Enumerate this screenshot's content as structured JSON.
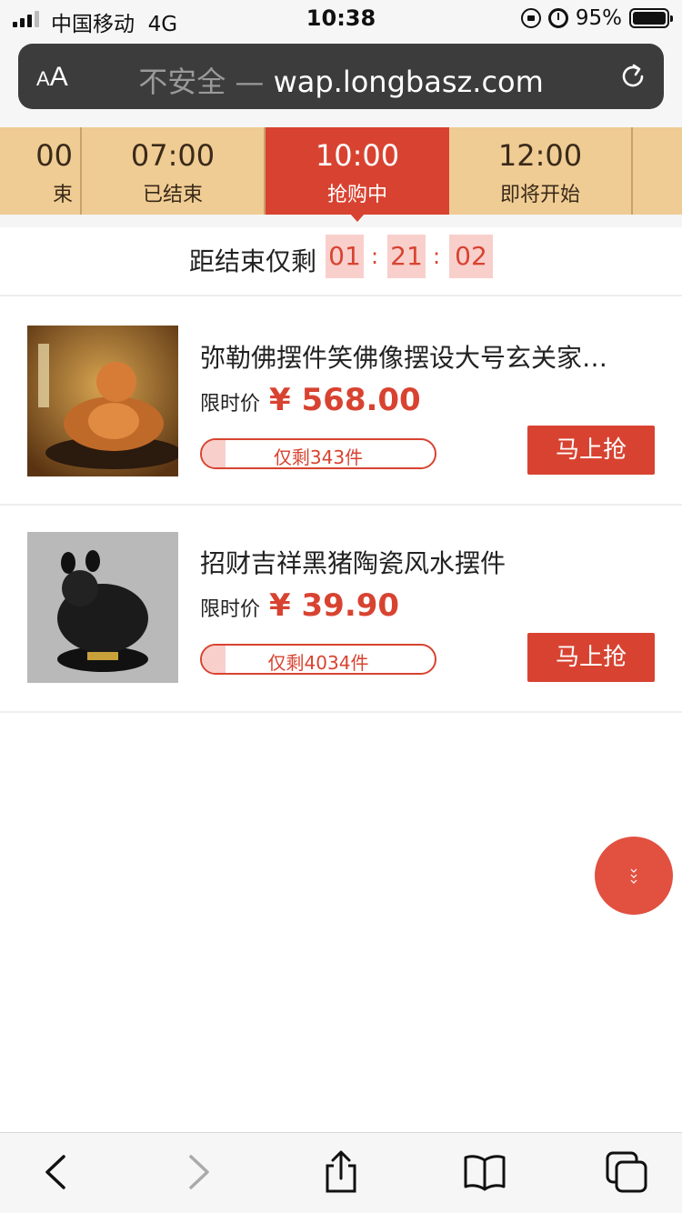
{
  "status_bar": {
    "carrier": "中国移动",
    "network": "4G",
    "time": "10:38",
    "battery": "95%"
  },
  "address_bar": {
    "text_size_label_small": "A",
    "text_size_label_large": "A",
    "security": "不安全 —",
    "domain": "wap.longbasz.com"
  },
  "tabs": [
    {
      "time": "00",
      "state": "束",
      "active": false
    },
    {
      "time": "07:00",
      "state": "已结束",
      "active": false
    },
    {
      "time": "10:00",
      "state": "抢购中",
      "active": true
    },
    {
      "time": "12:00",
      "state": "即将开始",
      "active": false
    }
  ],
  "countdown": {
    "label": "距结束仅剩",
    "hours": "01",
    "minutes": "21",
    "seconds": "02",
    "sep": ":"
  },
  "products": [
    {
      "title": "弥勒佛摆件笑佛像摆设大号玄关家…",
      "price_label": "限时价",
      "price": "¥ 568.00",
      "stock": "仅剩343件",
      "stock_fraction": 0.1,
      "button": "马上抢"
    },
    {
      "title": "招财吉祥黑猪陶瓷风水摆件",
      "price_label": "限时价",
      "price": "¥ 39.90",
      "stock": "仅剩4034件",
      "stock_fraction": 0.1,
      "button": "马上抢"
    }
  ],
  "colors": {
    "accent": "#d84331",
    "tab_bg": "#efcc93",
    "countdown_bg": "#f8cfcb"
  },
  "icons": {
    "float": "scroll-down-icon",
    "back": "back-icon",
    "forward": "forward-icon",
    "share": "share-icon",
    "bookmarks": "bookmarks-icon",
    "tabs": "tabs-icon"
  }
}
